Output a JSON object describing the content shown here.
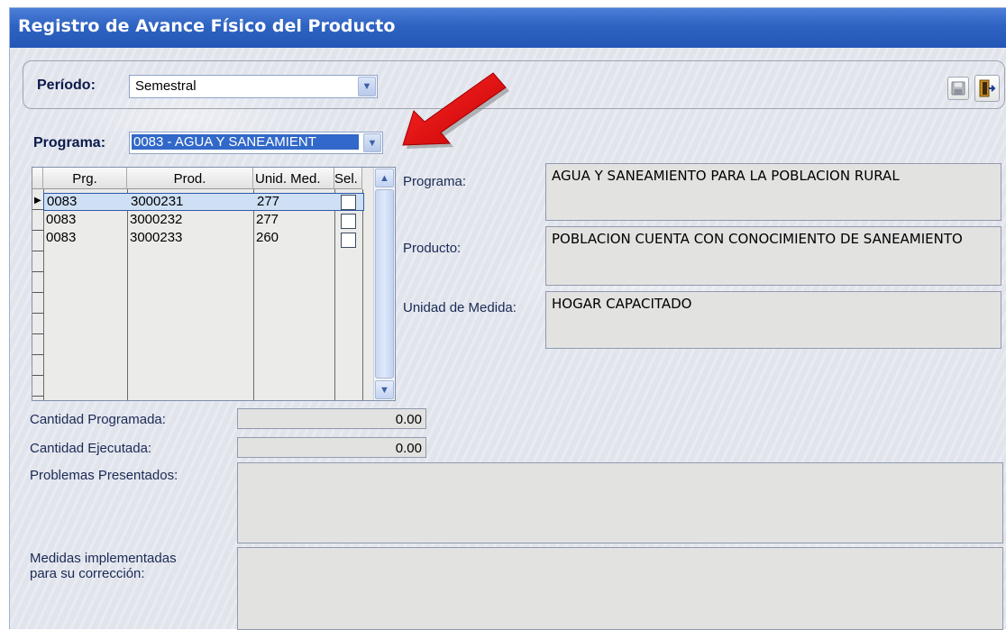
{
  "window": {
    "title": "Registro de Avance Físico del Producto"
  },
  "period": {
    "label": "Período:",
    "value": "Semestral"
  },
  "program_select": {
    "label": "Programa:",
    "value": "0083 - AGUA Y SANEAMIENT"
  },
  "grid": {
    "headers": [
      "Prg.",
      "Prod.",
      "Unid. Med.",
      "Sel."
    ],
    "rows": [
      {
        "prg": "0083",
        "prod": "3000231",
        "unid": "277",
        "sel": false
      },
      {
        "prg": "0083",
        "prod": "3000232",
        "unid": "277",
        "sel": false
      },
      {
        "prg": "0083",
        "prod": "3000233",
        "unid": "260",
        "sel": false
      }
    ]
  },
  "details": {
    "programa_label": "Programa:",
    "programa_value": "AGUA Y SANEAMIENTO PARA LA POBLACION RURAL",
    "producto_label": "Producto:",
    "producto_value": "POBLACION CUENTA CON CONOCIMIENTO DE SANEAMIENTO",
    "unidad_label": "Unidad de Medida:",
    "unidad_value": "HOGAR CAPACITADO"
  },
  "form": {
    "cant_prog_label": "Cantidad Programada:",
    "cant_prog_value": "0.00",
    "cant_ejec_label": "Cantidad Ejecutada:",
    "cant_ejec_value": "0.00",
    "problemas_label": "Problemas Presentados:",
    "medidas_label_1": "Medidas implementadas",
    "medidas_label_2": "para su corrección:"
  },
  "colors": {
    "title_bar": "#2f63c2",
    "annotation_arrow": "#e00000",
    "selection": "#cfe0f4"
  },
  "icons": [
    "save-icon",
    "exit-door-icon",
    "chevron-down-icon",
    "row-pointer-icon"
  ]
}
